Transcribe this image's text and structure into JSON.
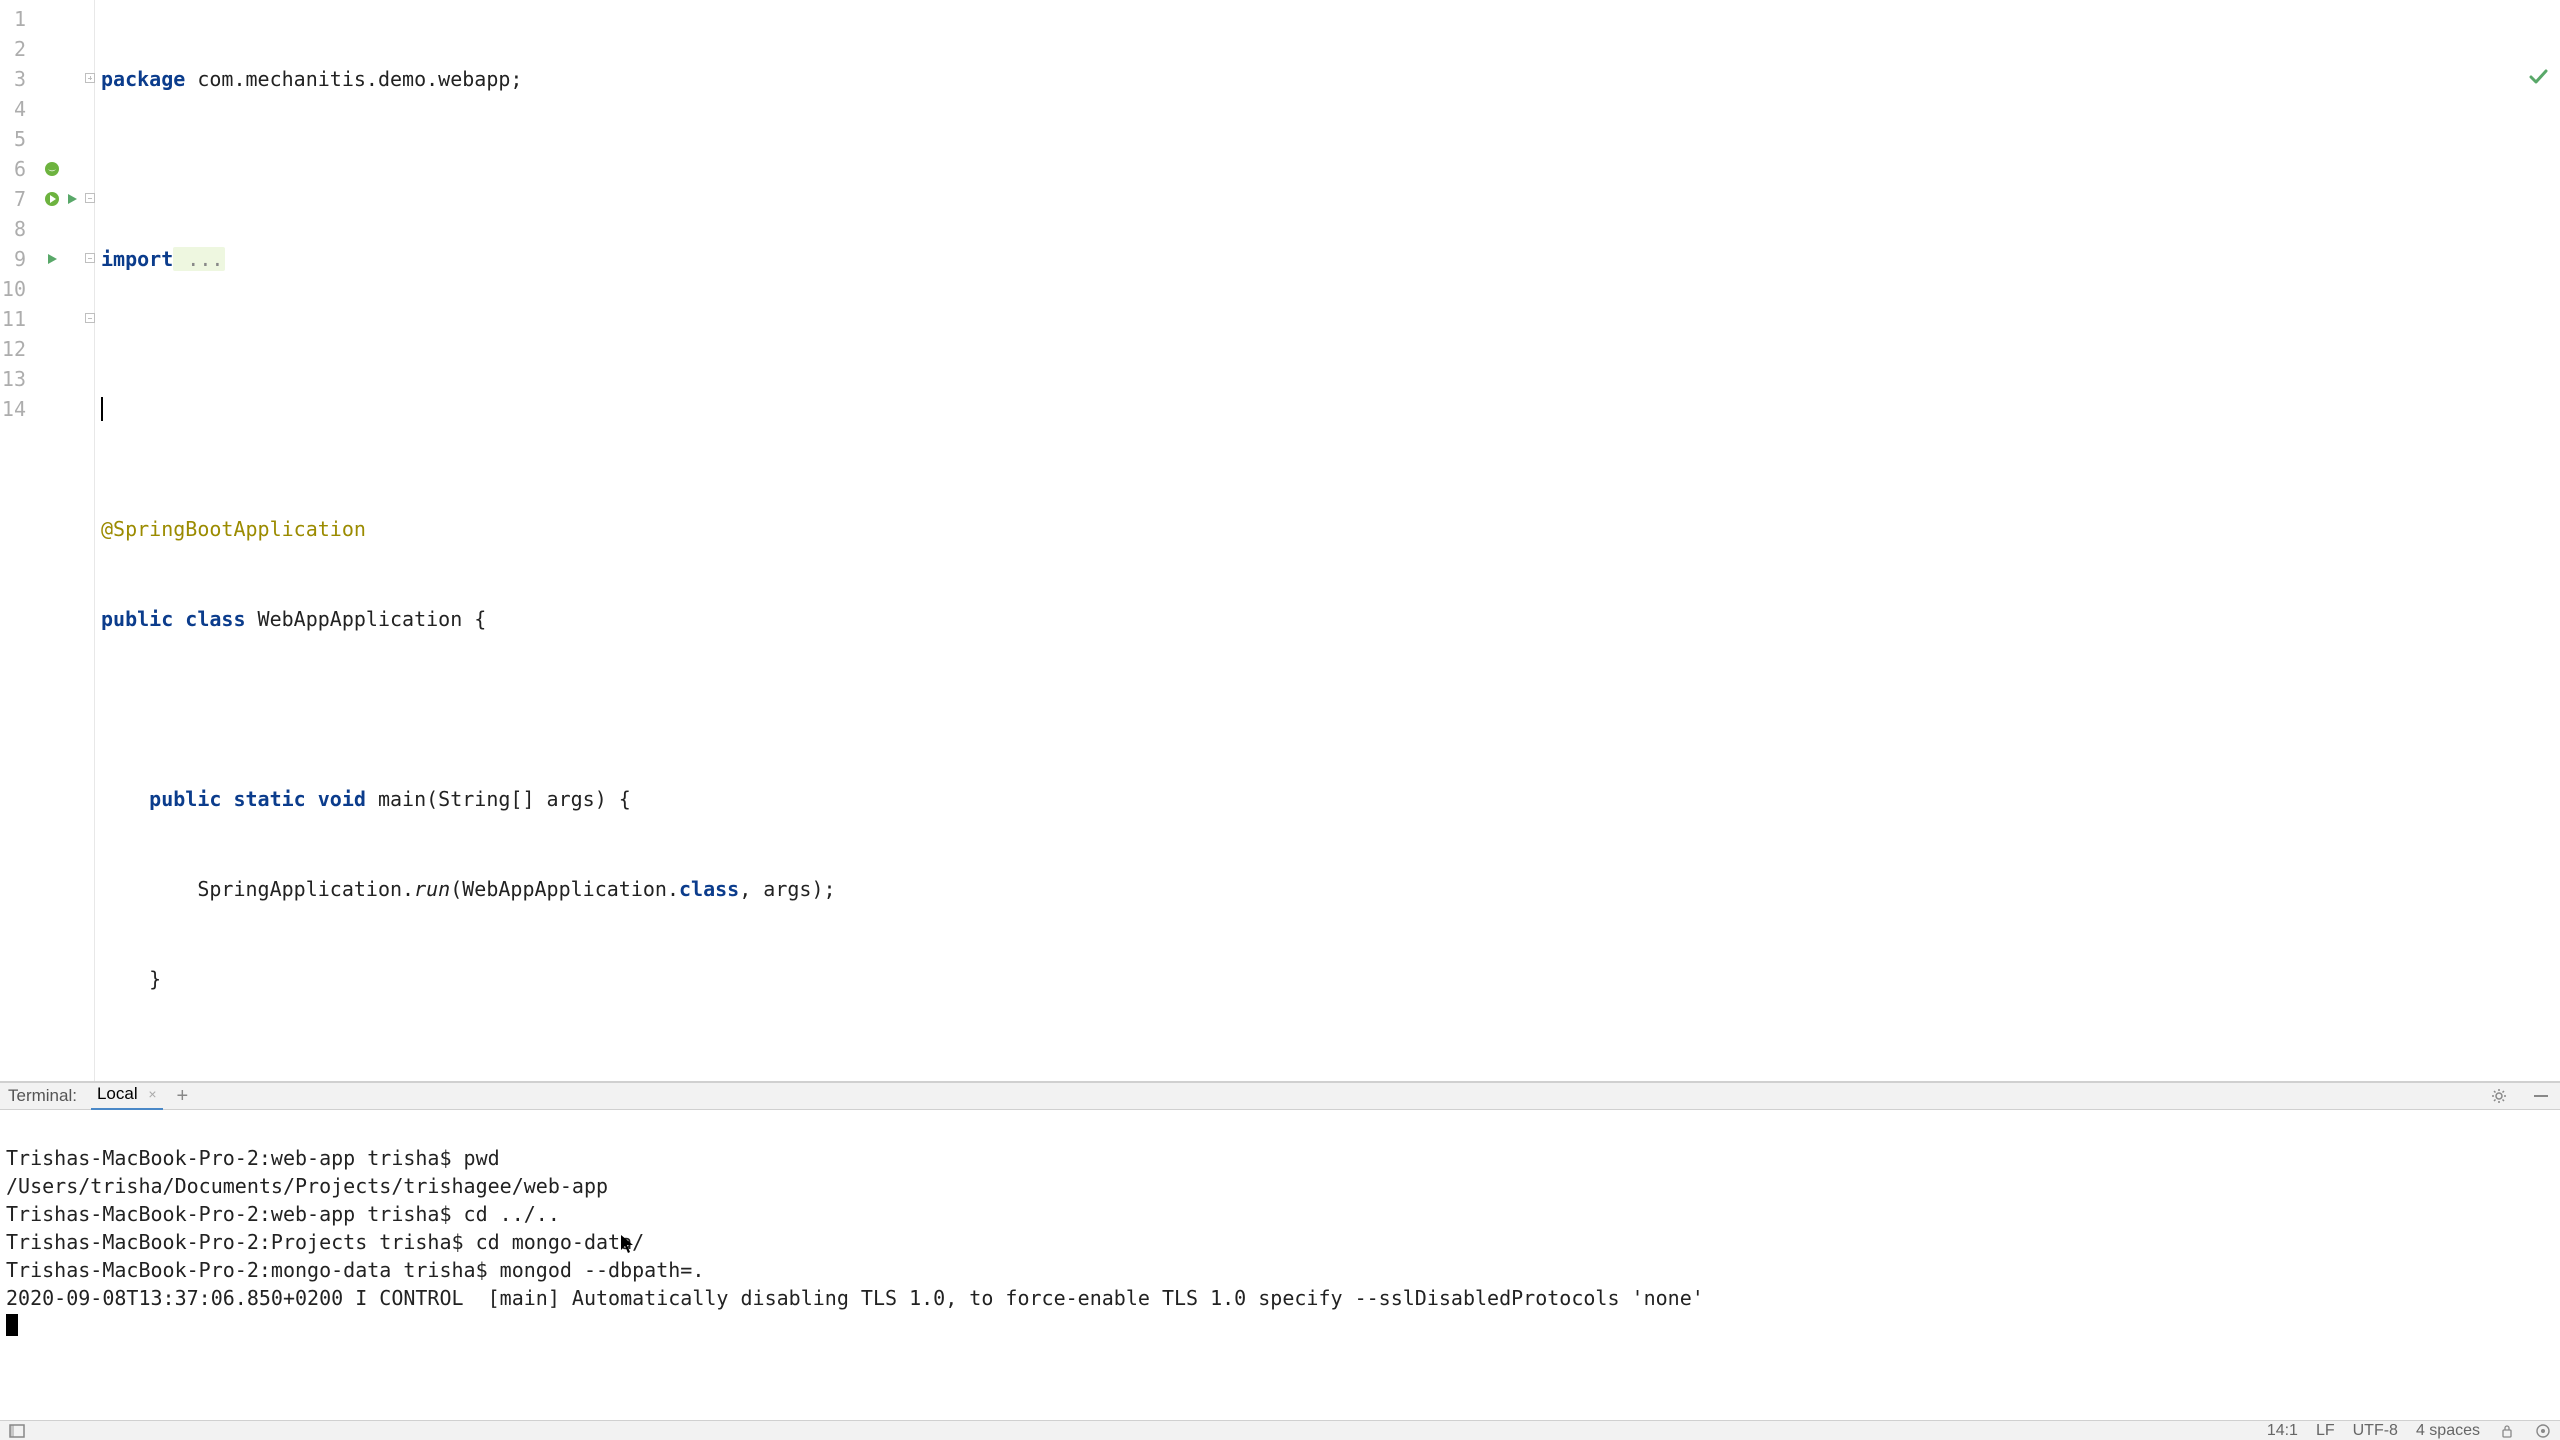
{
  "editor": {
    "lines": [
      "1",
      "2",
      "3",
      "4",
      "5",
      "6",
      "7",
      "8",
      "9",
      "10",
      "11",
      "12",
      "13",
      "14"
    ],
    "code": {
      "package_kw": "package",
      "package_name": " com.mechanitis.demo.webapp;",
      "import_kw": "import",
      "import_folded": " ...",
      "annotation": "@SpringBootApplication",
      "public_kw": "public",
      "class_kw": "class",
      "class_name": " WebAppApplication {",
      "static_kw": "static",
      "void_kw": "void",
      "main_sig": " main(String[] args) {",
      "spring_call_a": "SpringApplication.",
      "spring_call_run": "run",
      "spring_call_b": "(WebAppApplication.",
      "spring_class_kw": "class",
      "spring_call_c": ", args);",
      "brace_close": "}",
      "brace_close2": "}",
      "indent_method": "        ",
      "indent_body": "    "
    }
  },
  "terminal": {
    "title": "Terminal:",
    "tab_label": "Local",
    "lines": [
      "Trishas-MacBook-Pro-2:web-app trisha$ pwd",
      "/Users/trisha/Documents/Projects/trishagee/web-app",
      "Trishas-MacBook-Pro-2:web-app trisha$ cd ../..",
      "Trishas-MacBook-Pro-2:Projects trisha$ cd mongo-data/",
      "Trishas-MacBook-Pro-2:mongo-data trisha$ mongod --dbpath=.",
      "2020-09-08T13:37:06.850+0200 I CONTROL  [main] Automatically disabling TLS 1.0, to force-enable TLS 1.0 specify --sslDisabledProtocols 'none'"
    ]
  },
  "statusbar": {
    "caret": "14:1",
    "line_sep": "LF",
    "encoding": "UTF-8",
    "indent": "4 spaces"
  }
}
